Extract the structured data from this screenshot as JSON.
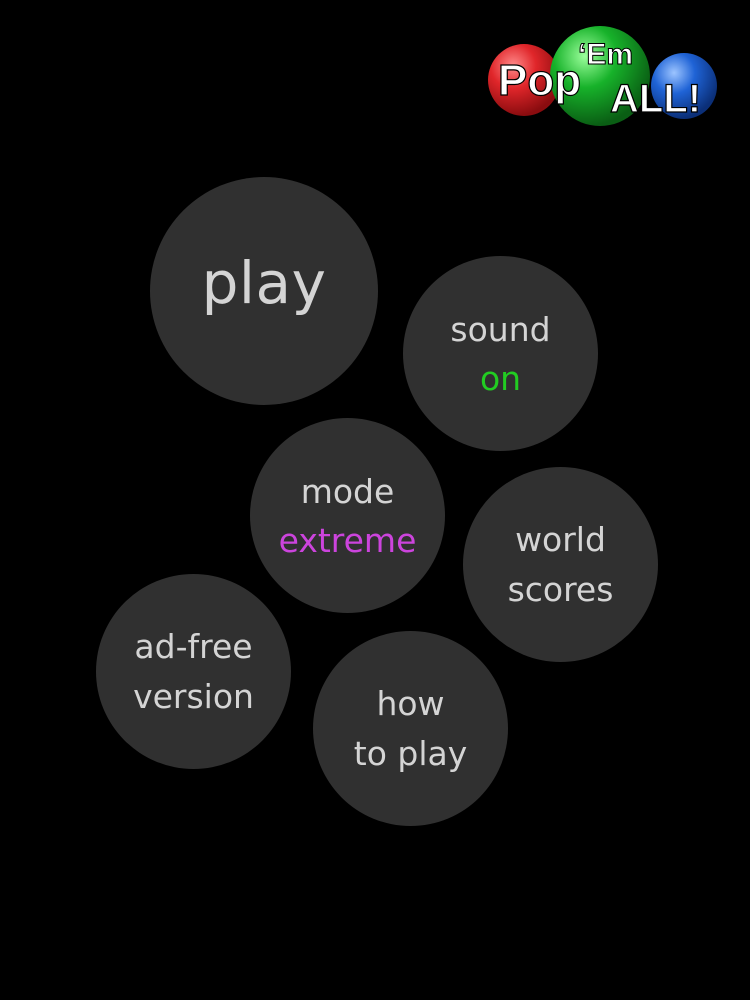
{
  "logo": {
    "word1": "Pop",
    "word2": "‘Em",
    "word3": "ALL!",
    "colors": {
      "red": "#e0262a",
      "green": "#17b22a",
      "blue": "#1f63d6"
    }
  },
  "menu": {
    "play": {
      "label": "play"
    },
    "sound": {
      "label": "sound",
      "value": "on",
      "value_color": "#22cc22"
    },
    "mode": {
      "label": "mode",
      "value": "extreme",
      "value_color": "#cc44dd"
    },
    "world_scores": {
      "line1": "world",
      "line2": "scores"
    },
    "ad_free": {
      "line1": "ad-free",
      "line2": "version"
    },
    "how_to_play": {
      "line1": "how",
      "line2": "to play"
    }
  }
}
